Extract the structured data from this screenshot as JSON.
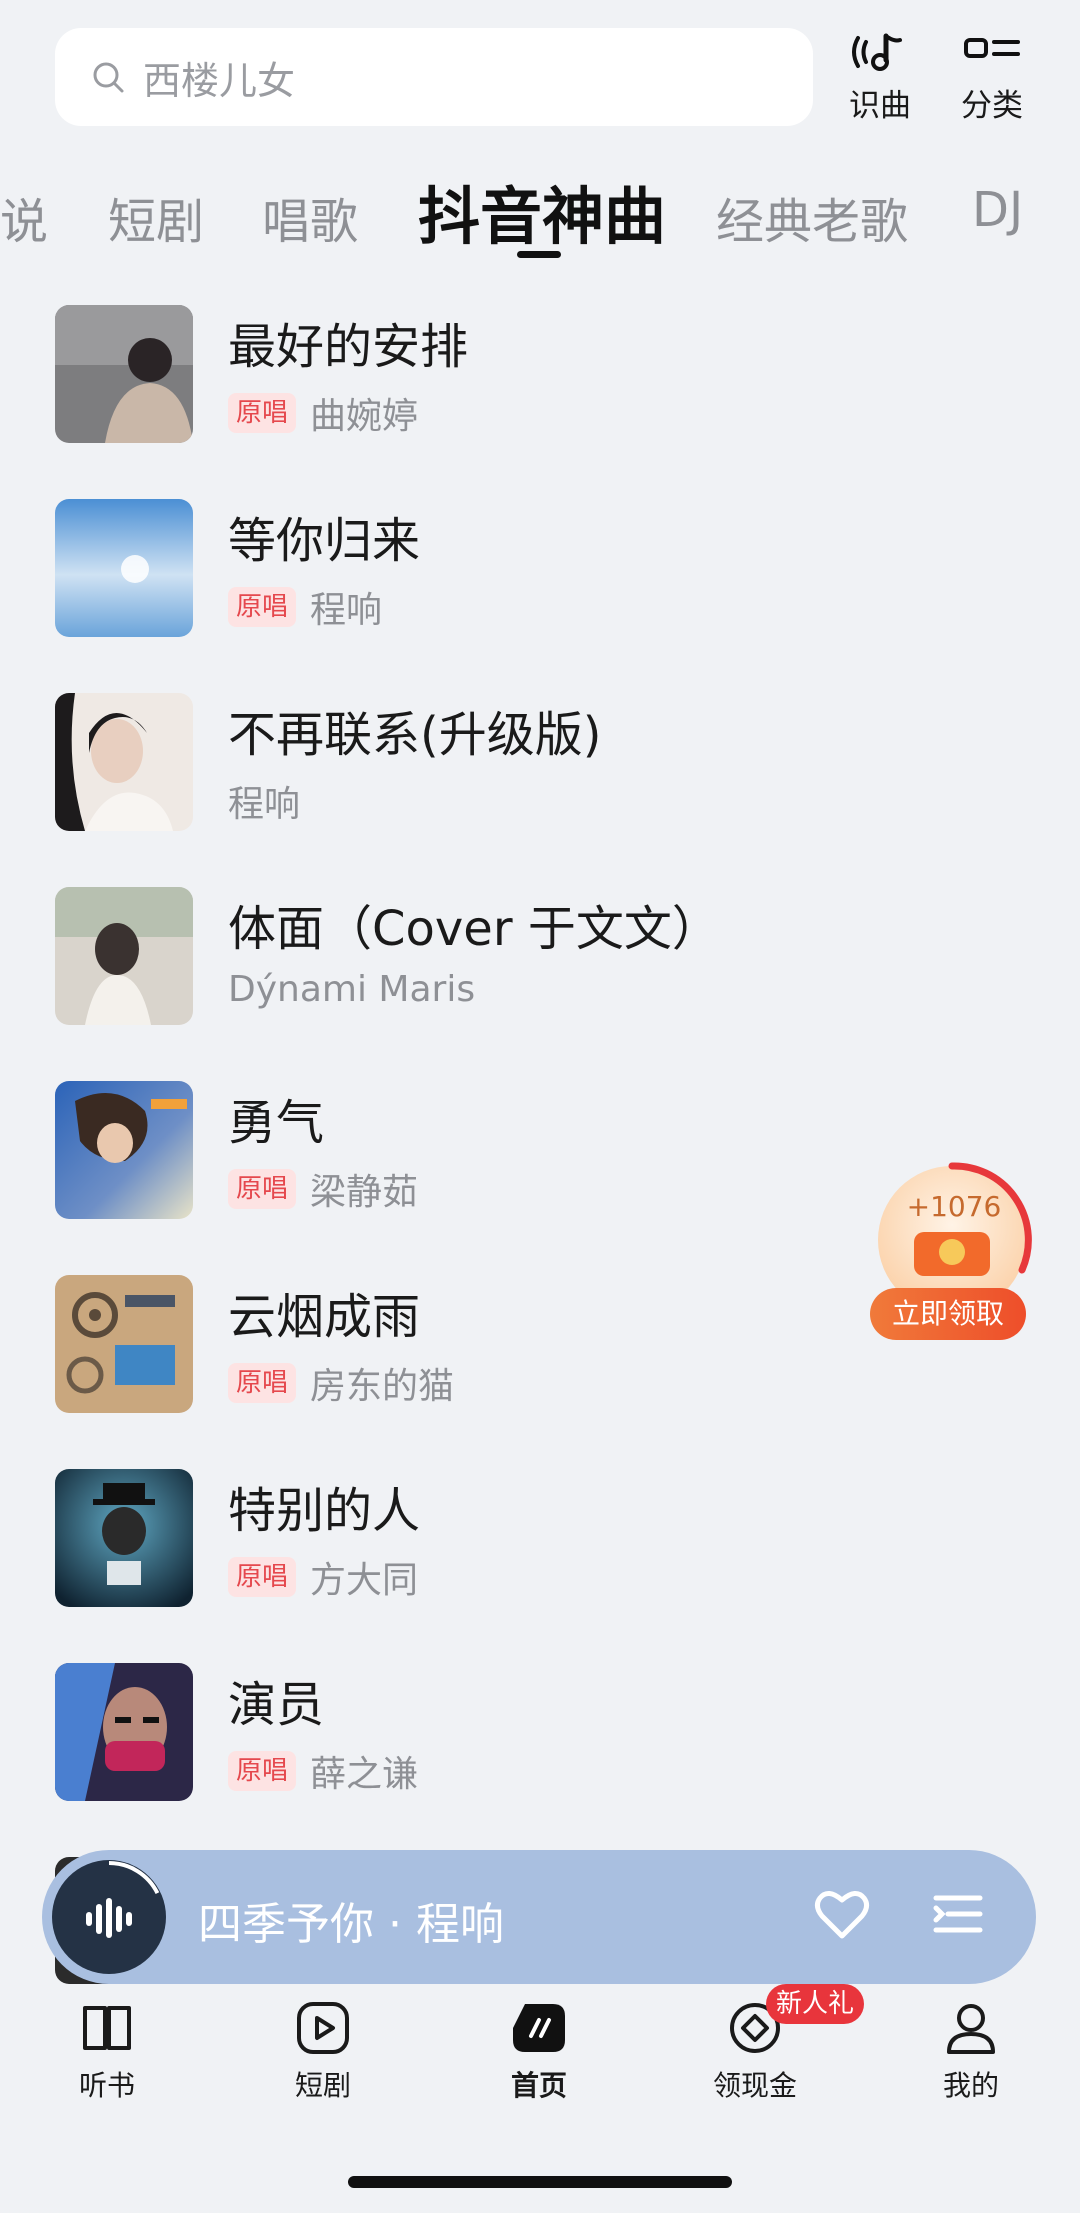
{
  "search": {
    "placeholder": "西楼儿女"
  },
  "top_actions": [
    {
      "label": "识曲",
      "icon": "music-recognize-icon"
    },
    {
      "label": "分类",
      "icon": "category-icon"
    }
  ],
  "tabs": [
    "说",
    "短剧",
    "唱歌",
    "抖音神曲",
    "经典老歌",
    "DJ"
  ],
  "active_tab": "抖音神曲",
  "songs": [
    {
      "title": "最好的安排",
      "badge": "原唱",
      "artist": "曲婉婷"
    },
    {
      "title": "等你归来",
      "badge": "原唱",
      "artist": "程响"
    },
    {
      "title": "不再联系(升级版)",
      "badge": "",
      "artist": "程响"
    },
    {
      "title": "体面（Cover 于文文）",
      "badge": "",
      "artist": "Dýnami Maris"
    },
    {
      "title": "勇气",
      "badge": "原唱",
      "artist": "梁静茹"
    },
    {
      "title": "云烟成雨",
      "badge": "原唱",
      "artist": "房东的猫"
    },
    {
      "title": "特别的人",
      "badge": "原唱",
      "artist": "方大同"
    },
    {
      "title": "演员",
      "badge": "原唱",
      "artist": "薛之谦"
    }
  ],
  "reward": {
    "amount": "+1076",
    "button": "立即领取"
  },
  "player": {
    "now_playing": "四季予你 · 程响"
  },
  "bottom_nav": [
    {
      "label": "听书",
      "icon": "book-icon"
    },
    {
      "label": "短剧",
      "icon": "play-icon"
    },
    {
      "label": "首页",
      "icon": "home-logo-icon"
    },
    {
      "label": "领现金",
      "icon": "coin-icon"
    },
    {
      "label": "我的",
      "icon": "profile-icon"
    }
  ],
  "nav_badge": "新人礼",
  "colors": {
    "accent_red": "#e5484d",
    "player_bg": "#a9bfe0",
    "background": "#f0f2f5"
  }
}
